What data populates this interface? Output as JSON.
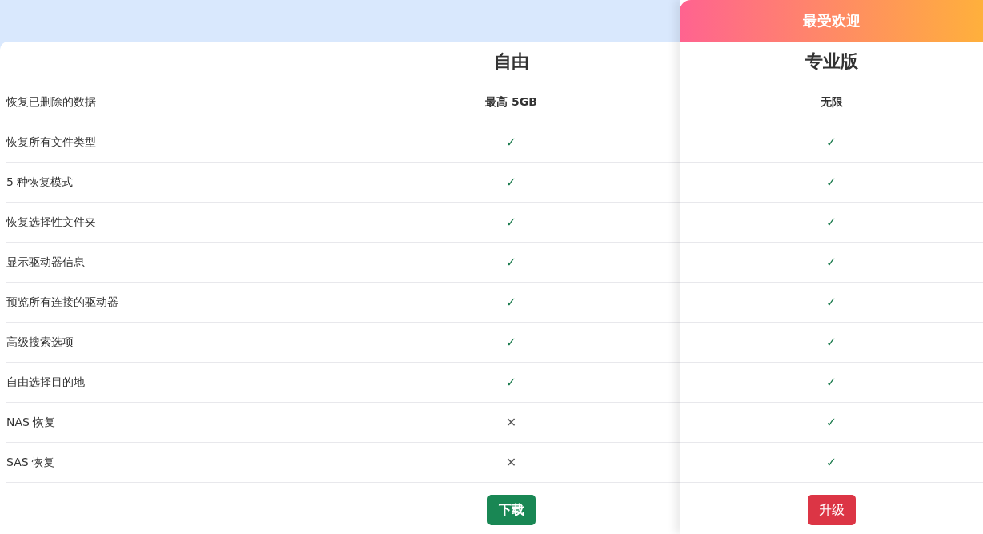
{
  "plans": [
    {
      "name": "自由",
      "button": {
        "label": "下载",
        "kind": "download"
      }
    },
    {
      "name": "专业版",
      "badge": "最受欢迎",
      "button": {
        "label": "升级",
        "kind": "upgrade"
      }
    }
  ],
  "features": [
    {
      "label": "恢复已删除的数据",
      "cells": [
        {
          "kind": "text",
          "text": "最高 5GB"
        },
        {
          "kind": "text",
          "text": "无限"
        }
      ]
    },
    {
      "label": "恢复所有文件类型",
      "cells": [
        {
          "kind": "mark",
          "included": true,
          "text": "✓"
        },
        {
          "kind": "mark",
          "included": true,
          "text": "✓"
        }
      ]
    },
    {
      "label": "5 种恢复模式",
      "cells": [
        {
          "kind": "mark",
          "included": true,
          "text": "✓"
        },
        {
          "kind": "mark",
          "included": true,
          "text": "✓"
        }
      ]
    },
    {
      "label": "恢复选择性文件夹",
      "cells": [
        {
          "kind": "mark",
          "included": true,
          "text": "✓"
        },
        {
          "kind": "mark",
          "included": true,
          "text": "✓"
        }
      ]
    },
    {
      "label": "显示驱动器信息",
      "cells": [
        {
          "kind": "mark",
          "included": true,
          "text": "✓"
        },
        {
          "kind": "mark",
          "included": true,
          "text": "✓"
        }
      ]
    },
    {
      "label": "预览所有连接的驱动器",
      "cells": [
        {
          "kind": "mark",
          "included": true,
          "text": "✓"
        },
        {
          "kind": "mark",
          "included": true,
          "text": "✓"
        }
      ]
    },
    {
      "label": "高级搜索选项",
      "cells": [
        {
          "kind": "mark",
          "included": true,
          "text": "✓"
        },
        {
          "kind": "mark",
          "included": true,
          "text": "✓"
        }
      ]
    },
    {
      "label": "自由选择目的地",
      "cells": [
        {
          "kind": "mark",
          "included": true,
          "text": "✓"
        },
        {
          "kind": "mark",
          "included": true,
          "text": "✓"
        }
      ]
    },
    {
      "label": "NAS 恢复",
      "cells": [
        {
          "kind": "mark",
          "included": false,
          "text": "✕"
        },
        {
          "kind": "mark",
          "included": true,
          "text": "✓"
        }
      ]
    },
    {
      "label": "SAS 恢复",
      "cells": [
        {
          "kind": "mark",
          "included": false,
          "text": "✕"
        },
        {
          "kind": "mark",
          "included": true,
          "text": "✓"
        }
      ]
    }
  ]
}
